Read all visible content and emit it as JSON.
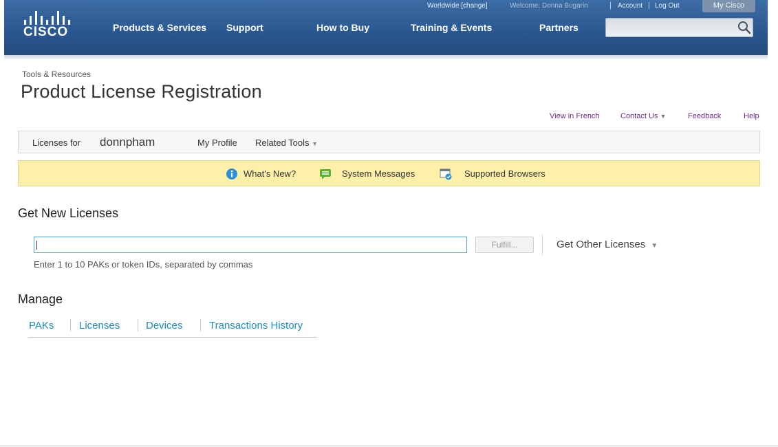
{
  "header": {
    "logo_text": "CISCO",
    "nav": [
      "Products & Services",
      "Support",
      "How to Buy",
      "Training & Events",
      "Partners"
    ],
    "util": {
      "worldwide": "Worldwide [change]",
      "welcome": "Welcome, Donna Bugarin",
      "account": "Account",
      "logout": "Log Out",
      "mycisco": "My Cisco"
    },
    "search": {
      "placeholder": ""
    }
  },
  "page": {
    "breadcrumb": "Tools & Resources",
    "title": "Product License Registration",
    "top_links": {
      "view_french": "View in French",
      "contact": "Contact Us",
      "feedback": "Feedback",
      "help": "Help"
    }
  },
  "license_bar": {
    "licenses_for": "Licenses for",
    "user": "donnpham",
    "my_profile": "My Profile",
    "related_tools": "Related Tools"
  },
  "message_bar": {
    "whats_new": "What's New?",
    "system_messages": "System Messages",
    "supported_browsers": "Supported Browsers"
  },
  "get_new": {
    "heading": "Get New Licenses",
    "input_value": "",
    "fulfill": "Fulfill...",
    "get_other": "Get Other Licenses",
    "hint": "Enter 1 to 10 PAKs or token IDs, separated by commas"
  },
  "manage": {
    "heading": "Manage",
    "tabs": [
      "PAKs",
      "Licenses",
      "Devices",
      "Transactions History"
    ]
  },
  "colors": {
    "header_blue": "#2a578f",
    "link_blue": "#1a8bc4",
    "link_purple": "#6b2a86",
    "message_yellow": "#fdf0a9"
  }
}
